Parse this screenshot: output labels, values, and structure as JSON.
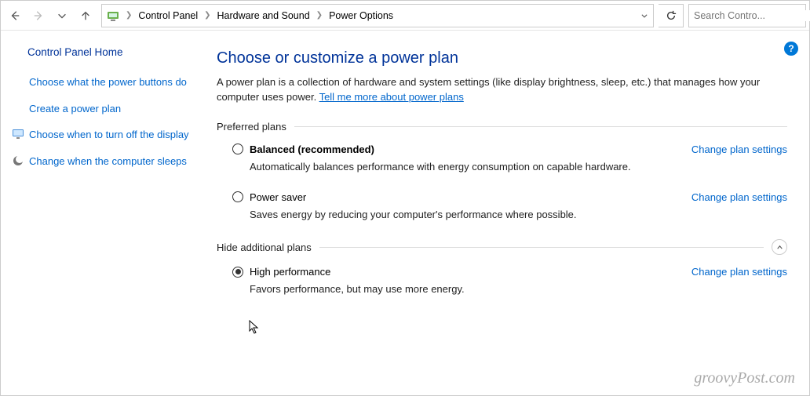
{
  "breadcrumb": {
    "items": [
      "Control Panel",
      "Hardware and Sound",
      "Power Options"
    ]
  },
  "search": {
    "placeholder": "Search Contro..."
  },
  "sidebar": {
    "home": "Control Panel Home",
    "links": [
      {
        "label": "Choose what the power buttons do",
        "icon": null
      },
      {
        "label": "Create a power plan",
        "icon": null
      },
      {
        "label": "Choose when to turn off the display",
        "icon": "monitor"
      },
      {
        "label": "Change when the computer sleeps",
        "icon": "moon"
      }
    ]
  },
  "page": {
    "title": "Choose or customize a power plan",
    "intro_prefix": "A power plan is a collection of hardware and system settings (like display brightness, sleep, etc.) that manages how your computer uses power. ",
    "intro_link": "Tell me more about power plans"
  },
  "sections": {
    "preferred_label": "Preferred plans",
    "additional_label": "Hide additional plans"
  },
  "plans": {
    "change_link": "Change plan settings",
    "preferred": [
      {
        "name": "Balanced (recommended)",
        "bold": true,
        "selected": false,
        "desc": "Automatically balances performance with energy consumption on capable hardware."
      },
      {
        "name": "Power saver",
        "bold": false,
        "selected": false,
        "desc": "Saves energy by reducing your computer's performance where possible."
      }
    ],
    "additional": [
      {
        "name": "High performance",
        "bold": false,
        "selected": true,
        "desc": "Favors performance, but may use more energy."
      }
    ]
  },
  "watermark": "groovyPost.com"
}
